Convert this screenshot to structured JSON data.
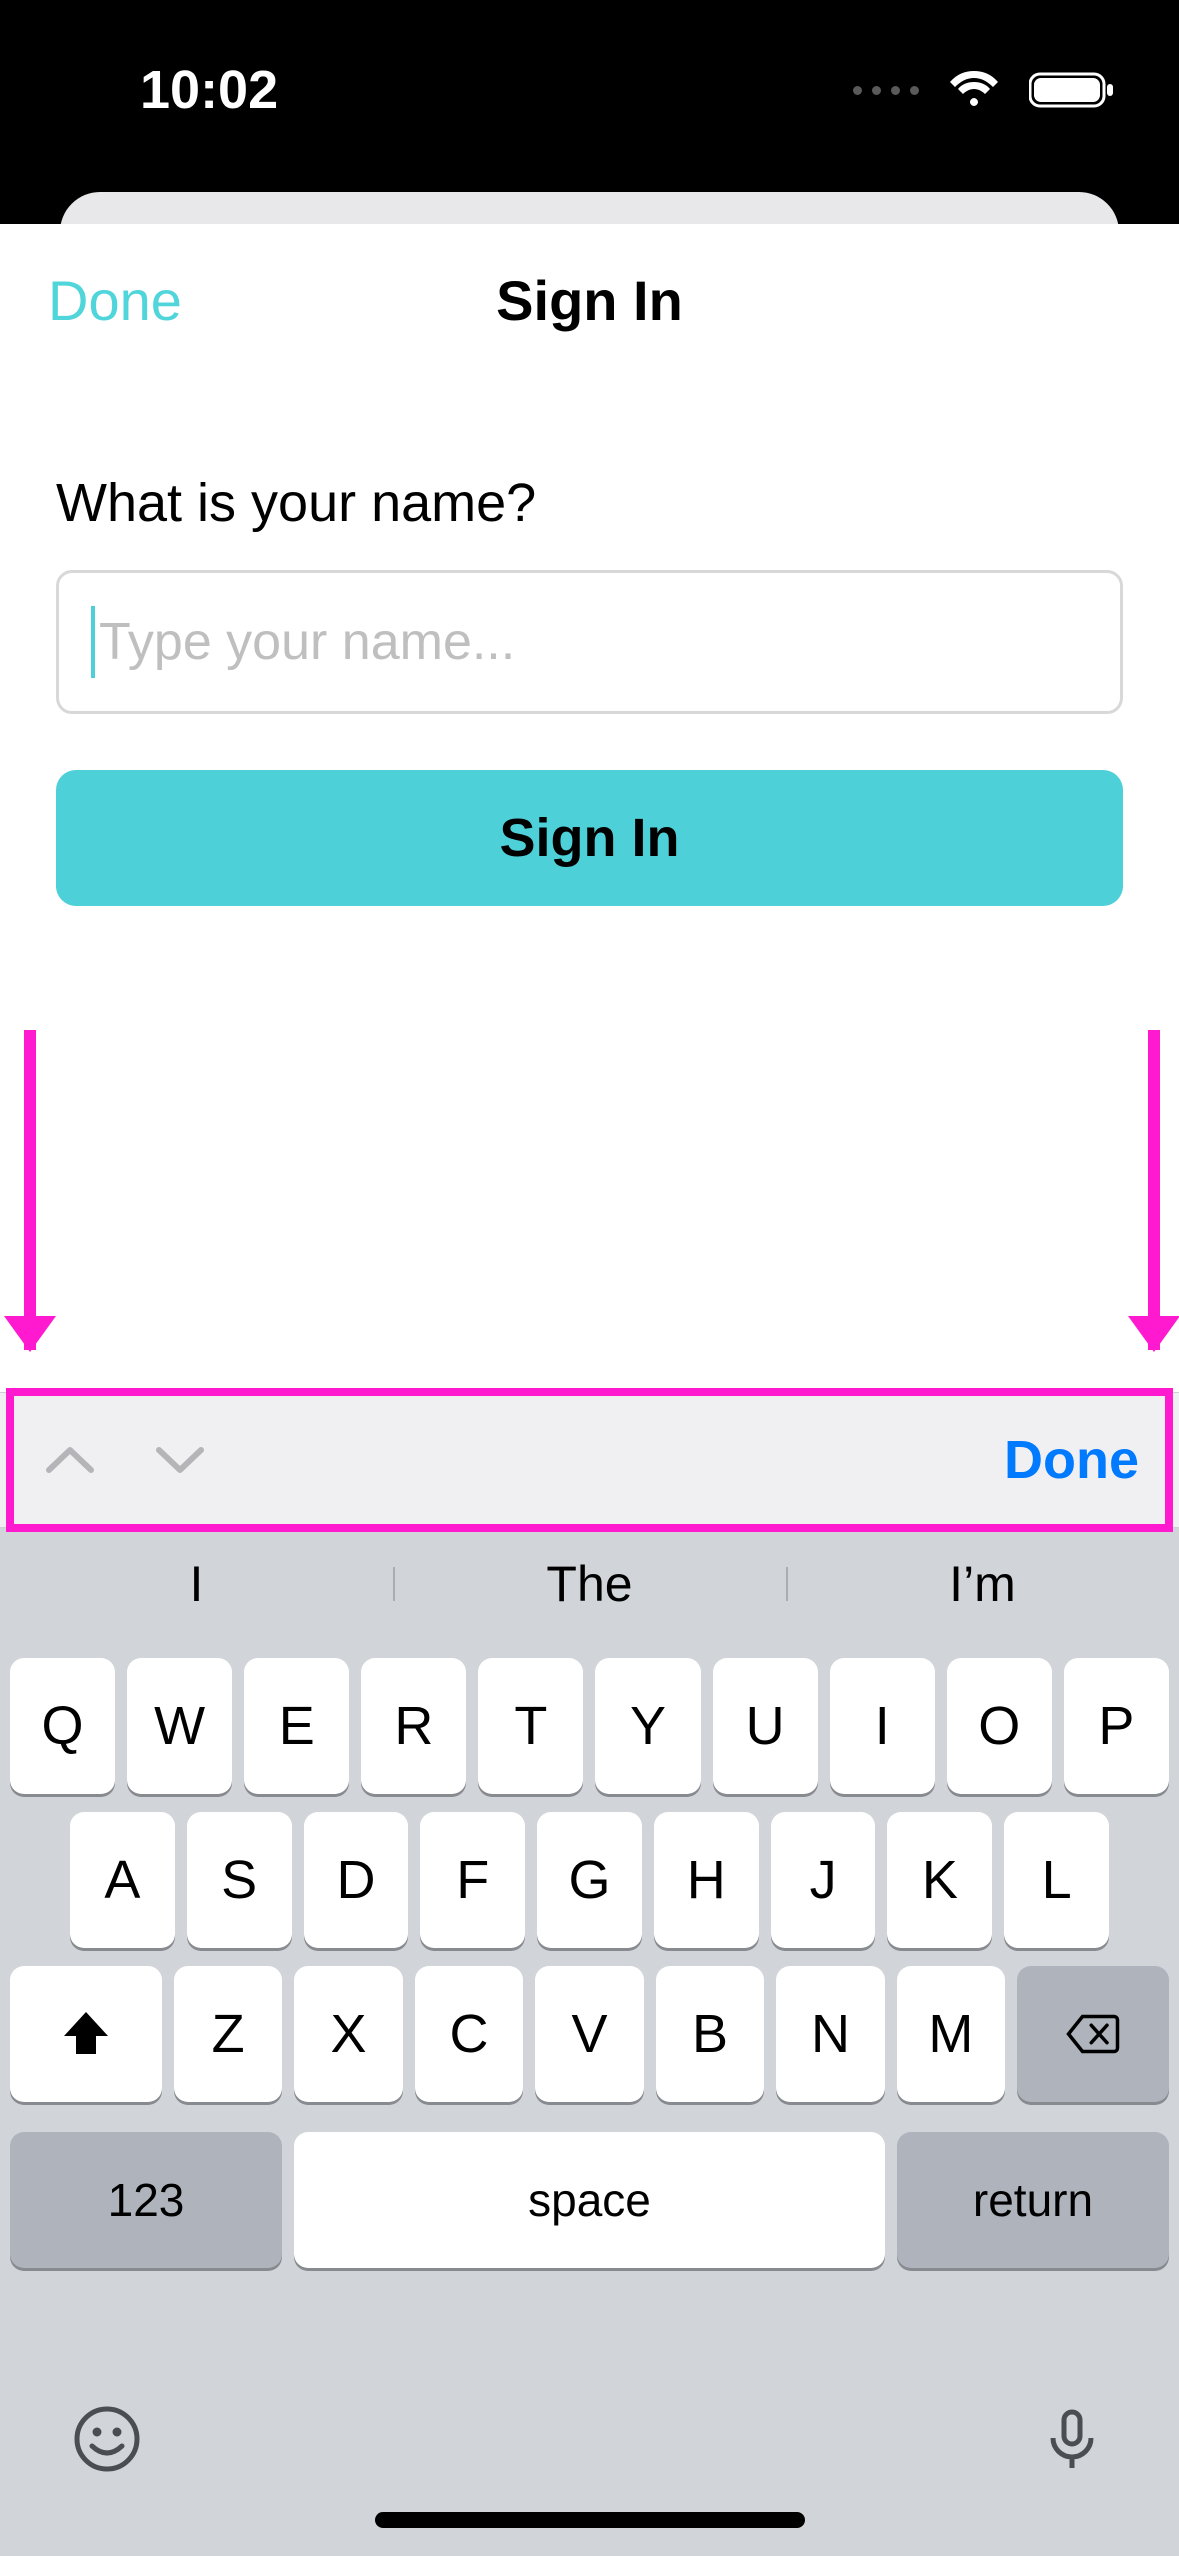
{
  "status": {
    "time": "10:02"
  },
  "sheet": {
    "done_label": "Done",
    "title": "Sign In",
    "prompt": "What is your name?",
    "name_placeholder": "Type your name...",
    "name_value": "",
    "signin_label": "Sign In"
  },
  "accessory": {
    "done_label": "Done"
  },
  "keyboard": {
    "suggestions": [
      "I",
      "The",
      "I’m"
    ],
    "row1": [
      "Q",
      "W",
      "E",
      "R",
      "T",
      "Y",
      "U",
      "I",
      "O",
      "P"
    ],
    "row2": [
      "A",
      "S",
      "D",
      "F",
      "G",
      "H",
      "J",
      "K",
      "L"
    ],
    "row3": [
      "Z",
      "X",
      "C",
      "V",
      "B",
      "N",
      "M"
    ],
    "numbers_label": "123",
    "space_label": "space",
    "return_label": "return"
  },
  "icons": {
    "wifi": "wifi-icon",
    "battery": "battery-icon",
    "chev_up": "chevron-up-icon",
    "chev_down": "chevron-down-icon",
    "shift": "shift-icon",
    "backspace": "backspace-icon",
    "emoji": "emoji-icon",
    "mic": "microphone-icon"
  }
}
